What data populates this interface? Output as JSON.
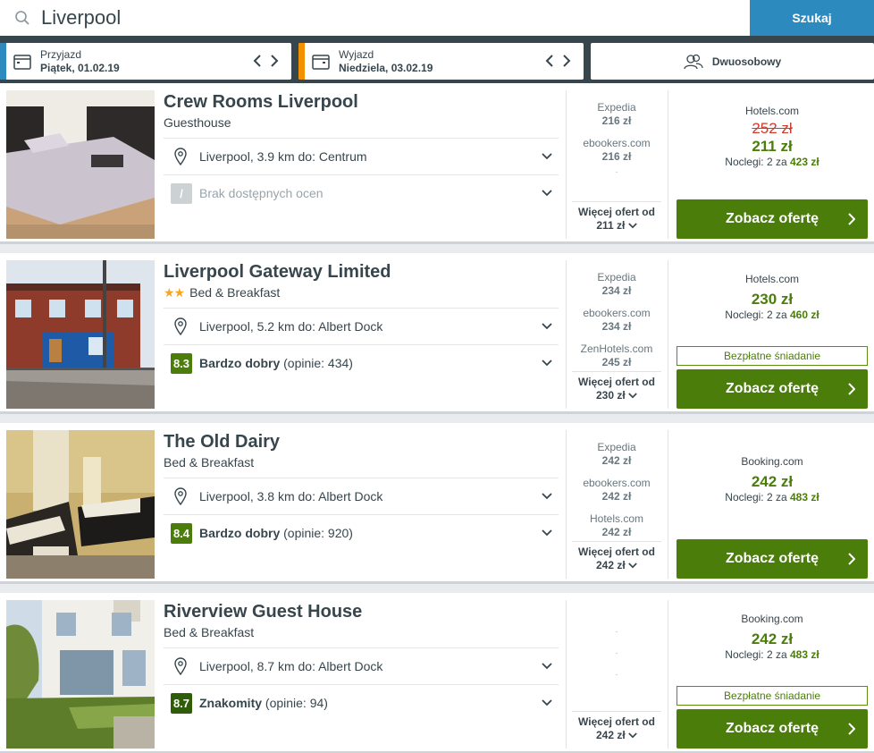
{
  "search": {
    "query": "Liverpool",
    "button_label": "Szukaj"
  },
  "checkin": {
    "label": "Przyjazd",
    "value": "Piątek, 01.02.19",
    "accent": "#2d8abf"
  },
  "checkout": {
    "label": "Wyjazd",
    "value": "Niedziela, 03.02.19",
    "accent": "#f29100"
  },
  "room": {
    "label": "Dwuosobowy"
  },
  "common": {
    "more_offers_label": "Więcej ofert od",
    "cta_label": "Zobacz ofertę",
    "nights_prefix": "Noclegi: 2 za",
    "free_breakfast": "Bezpłatne śniadanie"
  },
  "results": [
    {
      "name": "Crew Rooms Liverpool",
      "type": "Guesthouse",
      "location": "Liverpool, 3.9 km do: Centrum",
      "no_reviews": "Brak dostępnych ocen",
      "offers": [
        {
          "provider": "Expedia",
          "price": "216 zł"
        },
        {
          "provider": "ebookers.com",
          "price": "216 zł"
        }
      ],
      "more_price": "211 zł",
      "deal": {
        "provider": "Hotels.com",
        "old_price": "252 zł",
        "price": "211 zł",
        "total": "423 zł"
      }
    },
    {
      "name": "Liverpool Gateway Limited",
      "type": "Bed & Breakfast",
      "stars": "★★",
      "location": "Liverpool, 5.2 km do: Albert Dock",
      "rating": {
        "score": "8.3",
        "label": "Bardzo dobry",
        "reviews": "(opinie: 434)"
      },
      "offers": [
        {
          "provider": "Expedia",
          "price": "234 zł"
        },
        {
          "provider": "ebookers.com",
          "price": "234 zł"
        },
        {
          "provider": "ZenHotels.com",
          "price": "245 zł"
        }
      ],
      "more_price": "230 zł",
      "deal": {
        "provider": "Hotels.com",
        "price": "230 zł",
        "total": "460 zł"
      }
    },
    {
      "name": "The Old Dairy",
      "type": "Bed & Breakfast",
      "location": "Liverpool, 3.8 km do: Albert Dock",
      "rating": {
        "score": "8.4",
        "label": "Bardzo dobry",
        "reviews": "(opinie: 920)"
      },
      "offers": [
        {
          "provider": "Expedia",
          "price": "242 zł"
        },
        {
          "provider": "ebookers.com",
          "price": "242 zł"
        },
        {
          "provider": "Hotels.com",
          "price": "242 zł"
        }
      ],
      "more_price": "242 zł",
      "deal": {
        "provider": "Booking.com",
        "price": "242 zł",
        "total": "483 zł"
      }
    },
    {
      "name": "Riverview Guest House",
      "type": "Bed & Breakfast",
      "location": "Liverpool, 8.7 km do: Albert Dock",
      "rating": {
        "score": "8.7",
        "label": "Znakomity",
        "reviews": "(opinie: 94)"
      },
      "more_price": "242 zł",
      "deal": {
        "provider": "Booking.com",
        "price": "242 zł",
        "total": "483 zł"
      }
    }
  ],
  "colors": {
    "rating_good": "#4a7d0a",
    "rating_excellent": "#2f5d07",
    "cta": "#4a7d0a"
  }
}
